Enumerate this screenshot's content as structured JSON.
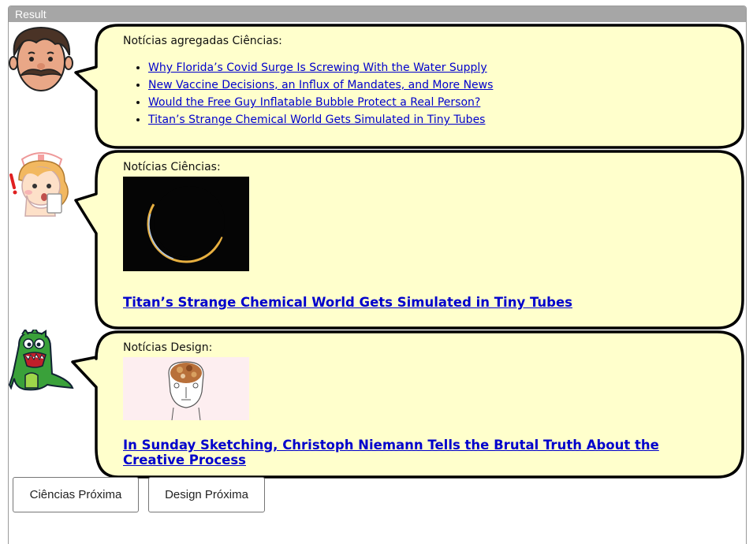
{
  "frame": {
    "title": "Result"
  },
  "rows": [
    {
      "avatar": "mustached-man-avatar",
      "label": "Notícias agregadas Ciências:",
      "links": [
        "Why Florida’s Covid Surge Is Screwing With the Water Supply",
        "New Vaccine Decisions, an Influx of Mandates, and More News",
        "Would the Free Guy Inflatable Bubble Protect a Real Person?",
        "Titan’s Strange Chemical World Gets Simulated in Tiny Tubes"
      ]
    },
    {
      "avatar": "nurse-avatar",
      "label": "Notícias Ciências:",
      "image": "titan-moon-crescent-image",
      "headline": "Titan’s Strange Chemical World Gets Simulated in Tiny Tubes"
    },
    {
      "avatar": "green-dinosaur-avatar",
      "label": "Notícias Design:",
      "image": "brain-sketch-image",
      "headline": "In Sunday Sketching, Christoph Niemann Tells the Brutal Truth About the Creative Process"
    }
  ],
  "buttons": {
    "science_next": "Ciências Próxima",
    "design_next": "Design Próxima"
  },
  "colors": {
    "bubble_fill": "#ffffcc",
    "link": "#0000cc",
    "header": "#a6a6a6"
  }
}
